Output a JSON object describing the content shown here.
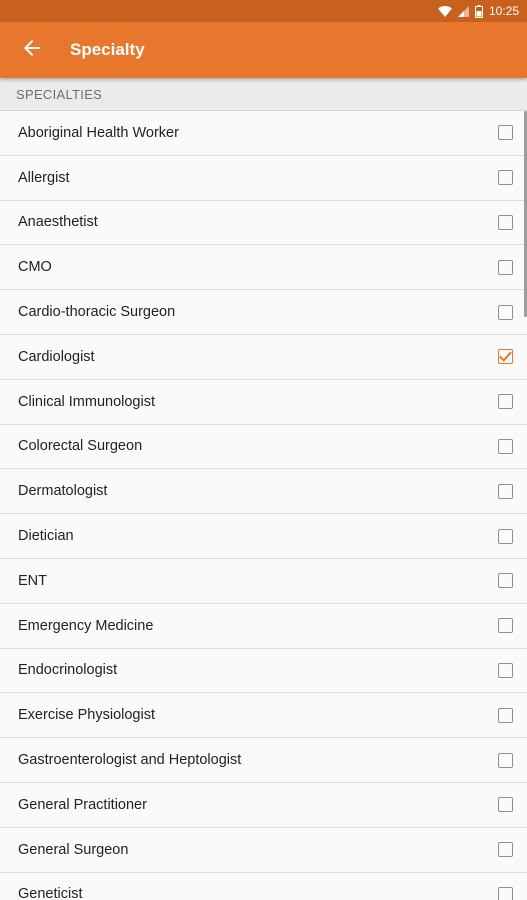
{
  "status_bar": {
    "time": "10:25",
    "icons": [
      "wifi-icon",
      "signal-icon",
      "battery-icon"
    ]
  },
  "app_bar": {
    "title": "Specialty",
    "back_icon": "arrow-left-icon",
    "color": "#e8772e"
  },
  "section": {
    "header": "SPECIALTIES"
  },
  "specialties": [
    {
      "label": "Aboriginal Health Worker",
      "checked": false
    },
    {
      "label": "Allergist",
      "checked": false
    },
    {
      "label": "Anaesthetist",
      "checked": false
    },
    {
      "label": "CMO",
      "checked": false
    },
    {
      "label": "Cardio-thoracic Surgeon",
      "checked": false
    },
    {
      "label": "Cardiologist",
      "checked": true
    },
    {
      "label": "Clinical Immunologist",
      "checked": false
    },
    {
      "label": "Colorectal Surgeon",
      "checked": false
    },
    {
      "label": "Dermatologist",
      "checked": false
    },
    {
      "label": "Dietician",
      "checked": false
    },
    {
      "label": "ENT",
      "checked": false
    },
    {
      "label": "Emergency Medicine",
      "checked": false
    },
    {
      "label": "Endocrinologist",
      "checked": false
    },
    {
      "label": "Exercise Physiologist",
      "checked": false
    },
    {
      "label": "Gastroenterologist and Heptologist",
      "checked": false
    },
    {
      "label": "General Practitioner",
      "checked": false
    },
    {
      "label": "General Surgeon",
      "checked": false
    },
    {
      "label": "Geneticist",
      "checked": false
    }
  ],
  "colors": {
    "accent": "#e8772e",
    "status_bar": "#c8611d"
  }
}
